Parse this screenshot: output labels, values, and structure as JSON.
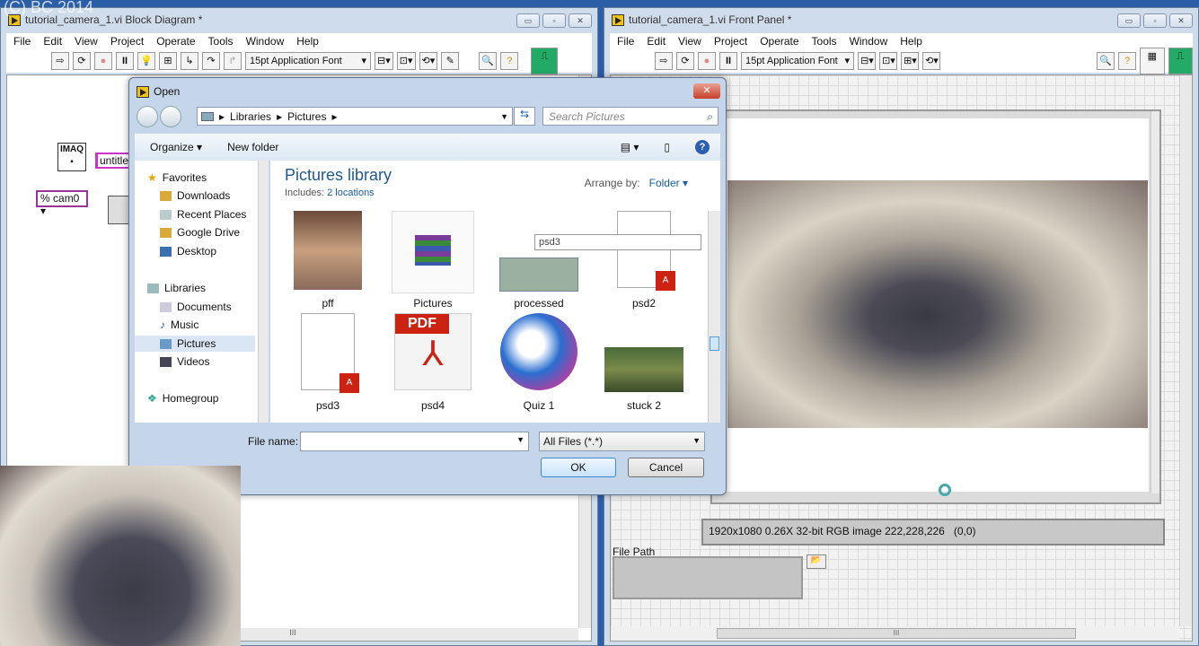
{
  "watermark": "(C) BC 2014",
  "block_diagram": {
    "title": "tutorial_camera_1.vi Block Diagram *",
    "menu": [
      "File",
      "Edit",
      "View",
      "Project",
      "Operate",
      "Tools",
      "Window",
      "Help"
    ],
    "font": "15pt Application Font",
    "nodes": {
      "imaq": "IMAQ",
      "untitled": "untitle",
      "camera": "cam0"
    },
    "scroll_grip": "III"
  },
  "front_panel": {
    "title": "tutorial_camera_1.vi Front Panel *",
    "menu": [
      "File",
      "Edit",
      "View",
      "Project",
      "Operate",
      "Tools",
      "Window",
      "Help"
    ],
    "font": "15pt Application Font",
    "image_status": "1920x1080 0.26X 32-bit RGB image 222,228,226",
    "image_coords": "(0,0)",
    "file_path_label": "File Path",
    "file_path_value": "",
    "scroll_grip": "III"
  },
  "dialog": {
    "title": "Open",
    "breadcrumb": [
      "Libraries",
      "Pictures"
    ],
    "search_placeholder": "Search Pictures",
    "organize": "Organize",
    "new_folder": "New folder",
    "nav": {
      "favorites": "Favorites",
      "favorite_items": [
        "Downloads",
        "Recent Places",
        "Google Drive",
        "Desktop"
      ],
      "libraries": "Libraries",
      "library_items": [
        "Documents",
        "Music",
        "Pictures",
        "Videos"
      ],
      "homegroup": "Homegroup",
      "selected": "Pictures"
    },
    "library_title": "Pictures library",
    "includes_label": "Includes:",
    "includes_link": "2 locations",
    "arrange_label": "Arrange by:",
    "arrange_value": "Folder",
    "tooltip": "psd3",
    "files": [
      {
        "name": "pff",
        "kind": "photo"
      },
      {
        "name": "Pictures",
        "kind": "archive"
      },
      {
        "name": "processed",
        "kind": "banknote"
      },
      {
        "name": "psd2",
        "kind": "pdf-doc"
      },
      {
        "name": "psd3",
        "kind": "pdf-doc"
      },
      {
        "name": "psd4",
        "kind": "pdf"
      },
      {
        "name": "Quiz 1",
        "kind": "app"
      },
      {
        "name": "stuck 2",
        "kind": "game"
      }
    ],
    "file_name_label": "File name:",
    "file_name_value": "",
    "filter": "All Files (*.*)",
    "ok": "OK",
    "cancel": "Cancel"
  }
}
